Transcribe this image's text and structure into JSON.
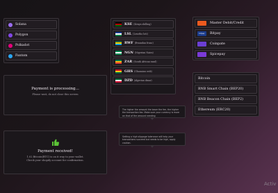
{
  "networks": [
    {
      "label": "Solana",
      "icon": "solana-icon",
      "color": "#9b6cf0"
    },
    {
      "label": "Polygon",
      "icon": "polygon-icon",
      "color": "#8247e5"
    },
    {
      "label": "Polkadot",
      "icon": "polkadot-icon",
      "color": "#e6007a"
    },
    {
      "label": "Fantom",
      "icon": "fantom-icon",
      "color": "#2aa6f2"
    }
  ],
  "currencies": [
    {
      "code": "KSE",
      "name": "(Kenya shilling)",
      "flag": [
        "#000000",
        "#bb0000",
        "#006600"
      ]
    },
    {
      "code": "LSL",
      "name": "(Lesotho loti)",
      "flag": [
        "#1a3a8f",
        "#ffffff",
        "#00864b"
      ]
    },
    {
      "code": "RWF",
      "name": "(Rwandan franc)",
      "flag": [
        "#20603d",
        "#fad201",
        "#00a1de"
      ]
    },
    {
      "code": "NGN",
      "name": "(Nigerian Naira)",
      "flag": [
        "#008751",
        "#ffffff",
        "#008751"
      ]
    },
    {
      "code": "ZAR",
      "name": "(South African rand)",
      "flag": [
        "#007a4d",
        "#ffb612",
        "#de3831"
      ]
    },
    {
      "code": "GHS",
      "name": "(Ghanaian cedi)",
      "flag": [
        "#ce1126",
        "#fcd116",
        "#006b3f"
      ]
    },
    {
      "code": "DZD",
      "name": "(Algerian dinar)",
      "flag": [
        "#006233",
        "#ffffff",
        "#d21034"
      ]
    }
  ],
  "methods": [
    {
      "label": "Master Debit/Credit",
      "icon": "mastercard-icon",
      "color": "#eb5a1e",
      "mark": ""
    },
    {
      "label": "Bitpay",
      "icon": "bitpay-icon",
      "color": "#1a3b8b",
      "mark": "bitpay"
    },
    {
      "label": "Coinpate",
      "icon": "coinpate-icon",
      "color": "#6b3fd4",
      "mark": ""
    },
    {
      "label": "Spicepay",
      "icon": "spicepay-icon",
      "color": "#7a3ad8",
      "mark": ""
    }
  ],
  "chains": [
    {
      "label": "Bitcoin"
    },
    {
      "label": "BNB Smart Chain (BEP20)"
    },
    {
      "label": "BNB Beacon Chain (BEP2)"
    },
    {
      "label": "Ethereum (ERC20)"
    }
  ],
  "processing": {
    "title": "Payment is processing...",
    "subtitle": "Please wait, do not close this screen"
  },
  "received": {
    "icon": "thumbs-up-icon",
    "icon_color": "#5bc236",
    "title": "Payment received!",
    "line1": "1.02 Bitcoin(BTC) is on it way to your wallet.",
    "line2": "Check your shopify account for confirmation."
  },
  "tips": {
    "tip1": "The higher the amount the lower the fee, the higher the transaction fee. Make sure your currency is more an that of the amount needing",
    "tip2": "Setting a high slippage tolerance will help your transactions succeed but needs to be high, apply caution."
  },
  "watermark": "Activ"
}
